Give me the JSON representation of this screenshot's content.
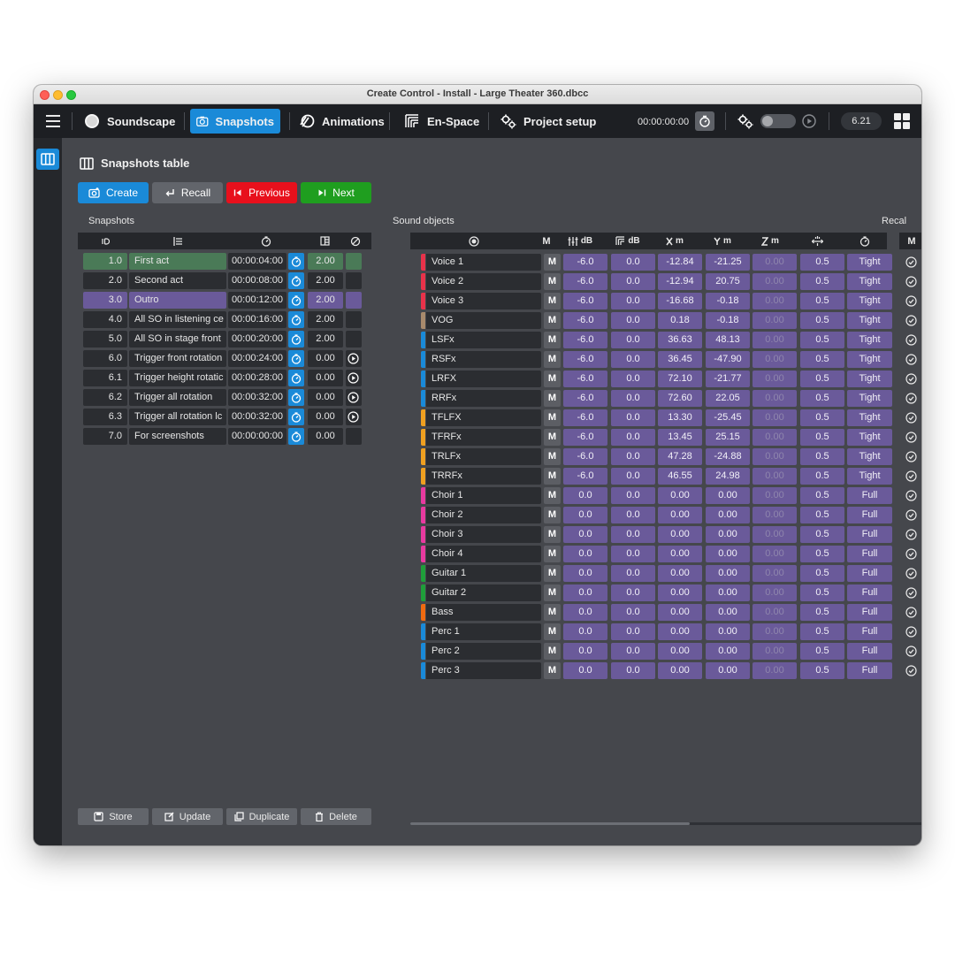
{
  "window": {
    "title": "Create Control - Install - Large Theater 360.dbcc"
  },
  "toolbar": {
    "tabs": [
      {
        "label": "Soundscape",
        "icon": "soundscape-icon"
      },
      {
        "label": "Snapshots",
        "icon": "camera-icon",
        "active": true
      },
      {
        "label": "Animations",
        "icon": "animations-icon"
      },
      {
        "label": "En-Space",
        "icon": "en-space-icon"
      },
      {
        "label": "Project setup",
        "icon": "gears-icon"
      }
    ],
    "time": "00:00:00:00",
    "version": "6.21"
  },
  "page": {
    "title": "Snapshots table"
  },
  "actions": {
    "create": "Create",
    "recall": "Recall",
    "previous": "Previous",
    "next": "Next"
  },
  "colors": {
    "accent": "#1a8ad8",
    "previous": "#e8101c",
    "next": "#1f9e1f",
    "selected_green": "#4a7a57",
    "selected_purple": "#6a5a9a"
  },
  "snapshots": {
    "title": "Snapshots",
    "rows": [
      {
        "id": "1.0",
        "name": "First act",
        "time": "00:00:04:00",
        "value": "2.00",
        "state": "green"
      },
      {
        "id": "2.0",
        "name": "Second act",
        "time": "00:00:08:00",
        "value": "2.00",
        "state": ""
      },
      {
        "id": "3.0",
        "name": "Outro",
        "time": "00:00:12:00",
        "value": "2.00",
        "state": "purple"
      },
      {
        "id": "4.0",
        "name": "All SO in listening ce",
        "time": "00:00:16:00",
        "value": "2.00",
        "state": ""
      },
      {
        "id": "5.0",
        "name": "All SO in stage front",
        "time": "00:00:20:00",
        "value": "2.00",
        "state": ""
      },
      {
        "id": "6.0",
        "name": "Trigger front rotation",
        "time": "00:00:24:00",
        "value": "0.00",
        "state": "",
        "play": true
      },
      {
        "id": "6.1",
        "name": "Trigger height rotatic",
        "time": "00:00:28:00",
        "value": "0.00",
        "state": "",
        "play": true
      },
      {
        "id": "6.2",
        "name": "Trigger all rotation",
        "time": "00:00:32:00",
        "value": "0.00",
        "state": "",
        "play": true
      },
      {
        "id": "6.3",
        "name": "Trigger all rotation lc",
        "time": "00:00:32:00",
        "value": "0.00",
        "state": "",
        "play": true
      },
      {
        "id": "7.0",
        "name": "For screenshots",
        "time": "00:00:00:00",
        "value": "0.00",
        "state": ""
      }
    ]
  },
  "sound_objects": {
    "title": "Sound objects",
    "headers": {
      "mute": "M",
      "gain": "dB",
      "delay": "dB",
      "x": "m",
      "y": "m",
      "z": "m"
    },
    "rows": [
      {
        "name": "Voice 1",
        "color": "#e8324a",
        "m": "M",
        "g1": "-6.0",
        "g2": "0.0",
        "x": "-12.84",
        "y": "-21.25",
        "z": "0.00",
        "spread": "0.5",
        "mode": "Tight"
      },
      {
        "name": "Voice 2",
        "color": "#e8324a",
        "m": "M",
        "g1": "-6.0",
        "g2": "0.0",
        "x": "-12.94",
        "y": "20.75",
        "z": "0.00",
        "spread": "0.5",
        "mode": "Tight"
      },
      {
        "name": "Voice 3",
        "color": "#e8324a",
        "m": "M",
        "g1": "-6.0",
        "g2": "0.0",
        "x": "-16.68",
        "y": "-0.18",
        "z": "0.00",
        "spread": "0.5",
        "mode": "Tight"
      },
      {
        "name": "VOG",
        "color": "#a88a6c",
        "m": "M",
        "g1": "-6.0",
        "g2": "0.0",
        "x": "0.18",
        "y": "-0.18",
        "z": "0.00",
        "spread": "0.5",
        "mode": "Tight"
      },
      {
        "name": "LSFx",
        "color": "#1a8ad8",
        "m": "M",
        "g1": "-6.0",
        "g2": "0.0",
        "x": "36.63",
        "y": "48.13",
        "z": "0.00",
        "spread": "0.5",
        "mode": "Tight"
      },
      {
        "name": "RSFx",
        "color": "#1a8ad8",
        "m": "M",
        "g1": "-6.0",
        "g2": "0.0",
        "x": "36.45",
        "y": "-47.90",
        "z": "0.00",
        "spread": "0.5",
        "mode": "Tight"
      },
      {
        "name": "LRFX",
        "color": "#1a8ad8",
        "m": "M",
        "g1": "-6.0",
        "g2": "0.0",
        "x": "72.10",
        "y": "-21.77",
        "z": "0.00",
        "spread": "0.5",
        "mode": "Tight"
      },
      {
        "name": "RRFx",
        "color": "#1a8ad8",
        "m": "M",
        "g1": "-6.0",
        "g2": "0.0",
        "x": "72.60",
        "y": "22.05",
        "z": "0.00",
        "spread": "0.5",
        "mode": "Tight"
      },
      {
        "name": "TFLFX",
        "color": "#f0a020",
        "m": "M",
        "g1": "-6.0",
        "g2": "0.0",
        "x": "13.30",
        "y": "-25.45",
        "z": "0.00",
        "spread": "0.5",
        "mode": "Tight"
      },
      {
        "name": "TFRFx",
        "color": "#f0a020",
        "m": "M",
        "g1": "-6.0",
        "g2": "0.0",
        "x": "13.45",
        "y": "25.15",
        "z": "0.00",
        "spread": "0.5",
        "mode": "Tight"
      },
      {
        "name": "TRLFx",
        "color": "#f0a020",
        "m": "M",
        "g1": "-6.0",
        "g2": "0.0",
        "x": "47.28",
        "y": "-24.88",
        "z": "0.00",
        "spread": "0.5",
        "mode": "Tight"
      },
      {
        "name": "TRRFx",
        "color": "#f0a020",
        "m": "M",
        "g1": "-6.0",
        "g2": "0.0",
        "x": "46.55",
        "y": "24.98",
        "z": "0.00",
        "spread": "0.5",
        "mode": "Tight"
      },
      {
        "name": "Choir 1",
        "color": "#e83aa0",
        "m": "M",
        "g1": "0.0",
        "g2": "0.0",
        "x": "0.00",
        "y": "0.00",
        "z": "0.00",
        "spread": "0.5",
        "mode": "Full"
      },
      {
        "name": "Choir 2",
        "color": "#e83aa0",
        "m": "M",
        "g1": "0.0",
        "g2": "0.0",
        "x": "0.00",
        "y": "0.00",
        "z": "0.00",
        "spread": "0.5",
        "mode": "Full"
      },
      {
        "name": "Choir 3",
        "color": "#e83aa0",
        "m": "M",
        "g1": "0.0",
        "g2": "0.0",
        "x": "0.00",
        "y": "0.00",
        "z": "0.00",
        "spread": "0.5",
        "mode": "Full"
      },
      {
        "name": "Choir 4",
        "color": "#e83aa0",
        "m": "M",
        "g1": "0.0",
        "g2": "0.0",
        "x": "0.00",
        "y": "0.00",
        "z": "0.00",
        "spread": "0.5",
        "mode": "Full"
      },
      {
        "name": "Guitar 1",
        "color": "#1f9e3a",
        "m": "M",
        "g1": "0.0",
        "g2": "0.0",
        "x": "0.00",
        "y": "0.00",
        "z": "0.00",
        "spread": "0.5",
        "mode": "Full"
      },
      {
        "name": "Guitar 2",
        "color": "#1f9e3a",
        "m": "M",
        "g1": "0.0",
        "g2": "0.0",
        "x": "0.00",
        "y": "0.00",
        "z": "0.00",
        "spread": "0.5",
        "mode": "Full"
      },
      {
        "name": "Bass",
        "color": "#f06a10",
        "m": "M",
        "g1": "0.0",
        "g2": "0.0",
        "x": "0.00",
        "y": "0.00",
        "z": "0.00",
        "spread": "0.5",
        "mode": "Full"
      },
      {
        "name": "Perc 1",
        "color": "#1a8ad8",
        "m": "M",
        "g1": "0.0",
        "g2": "0.0",
        "x": "0.00",
        "y": "0.00",
        "z": "0.00",
        "spread": "0.5",
        "mode": "Full"
      },
      {
        "name": "Perc 2",
        "color": "#1a8ad8",
        "m": "M",
        "g1": "0.0",
        "g2": "0.0",
        "x": "0.00",
        "y": "0.00",
        "z": "0.00",
        "spread": "0.5",
        "mode": "Full"
      },
      {
        "name": "Perc 3",
        "color": "#1a8ad8",
        "m": "M",
        "g1": "0.0",
        "g2": "0.0",
        "x": "0.00",
        "y": "0.00",
        "z": "0.00",
        "spread": "0.5",
        "mode": "Full"
      }
    ]
  },
  "recall": {
    "title": "Recal",
    "header": "M"
  },
  "bottom": {
    "store": "Store",
    "update": "Update",
    "duplicate": "Duplicate",
    "delete": "Delete"
  }
}
